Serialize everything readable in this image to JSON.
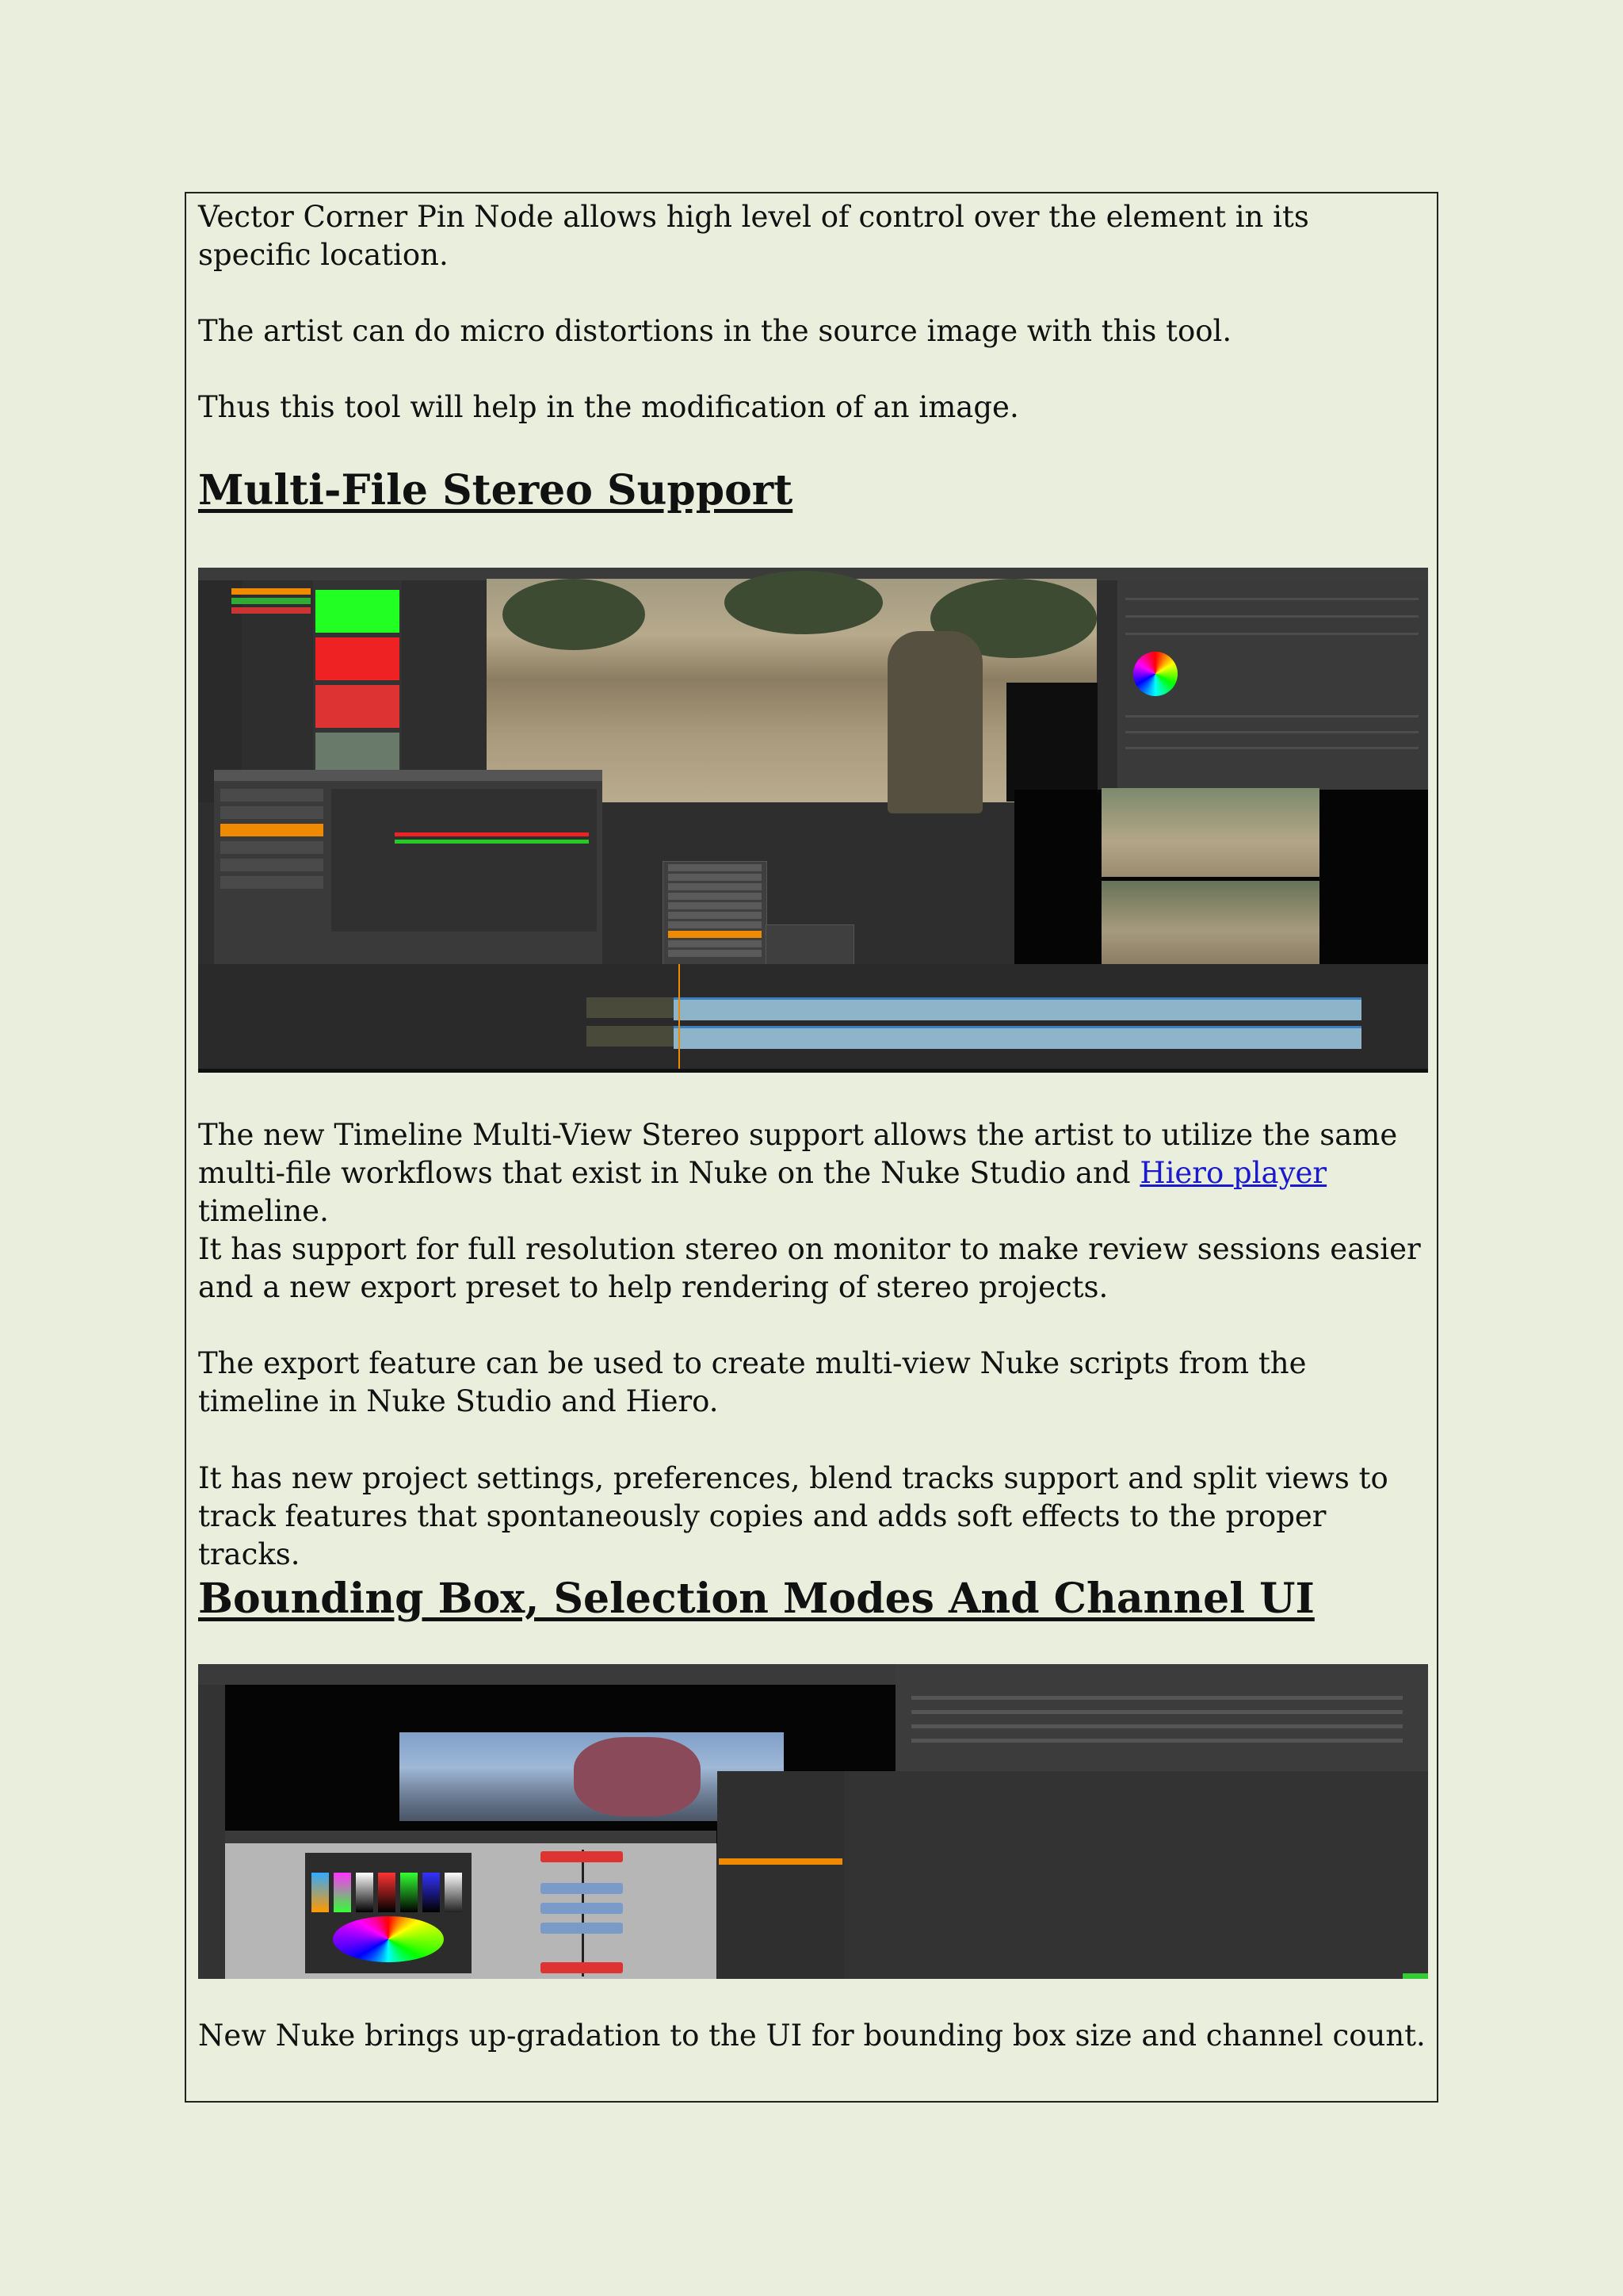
{
  "section_intro": {
    "paragraphs": [
      "Vector Corner Pin Node allows high level of control over the element in its specific location.",
      "The artist can do micro distortions in the source image with this tool.",
      "Thus this tool will help in the modification of an image."
    ]
  },
  "section_stereo": {
    "heading": "Multi-File Stereo Support",
    "p1_before_link": "The new Timeline Multi-View Stereo support allows the artist to utilize the same multi-file workflows that exist in Nuke on the Nuke Studio and ",
    "p1_link": "Hiero player",
    "p1_after_link": " timeline.",
    "paragraphs": [
      "It has support for full resolution stereo on monitor to make review sessions easier and a new export preset to help rendering of stereo projects.",
      "The export feature can be used to create multi-view Nuke scripts from the timeline in Nuke Studio and Hiero.",
      "It has new project settings, preferences, blend tracks support and split views to track features that spontaneously copies and adds soft effects to the proper tracks."
    ]
  },
  "section_bbox": {
    "heading": "Bounding Box, Selection Modes And Channel UI",
    "paragraph": "New Nuke brings up-gradation to the UI for bounding box size and channel count."
  },
  "colors": {
    "background": "#eaeedd",
    "link": "#1a1acc",
    "ui_accent": "#f08a00"
  }
}
